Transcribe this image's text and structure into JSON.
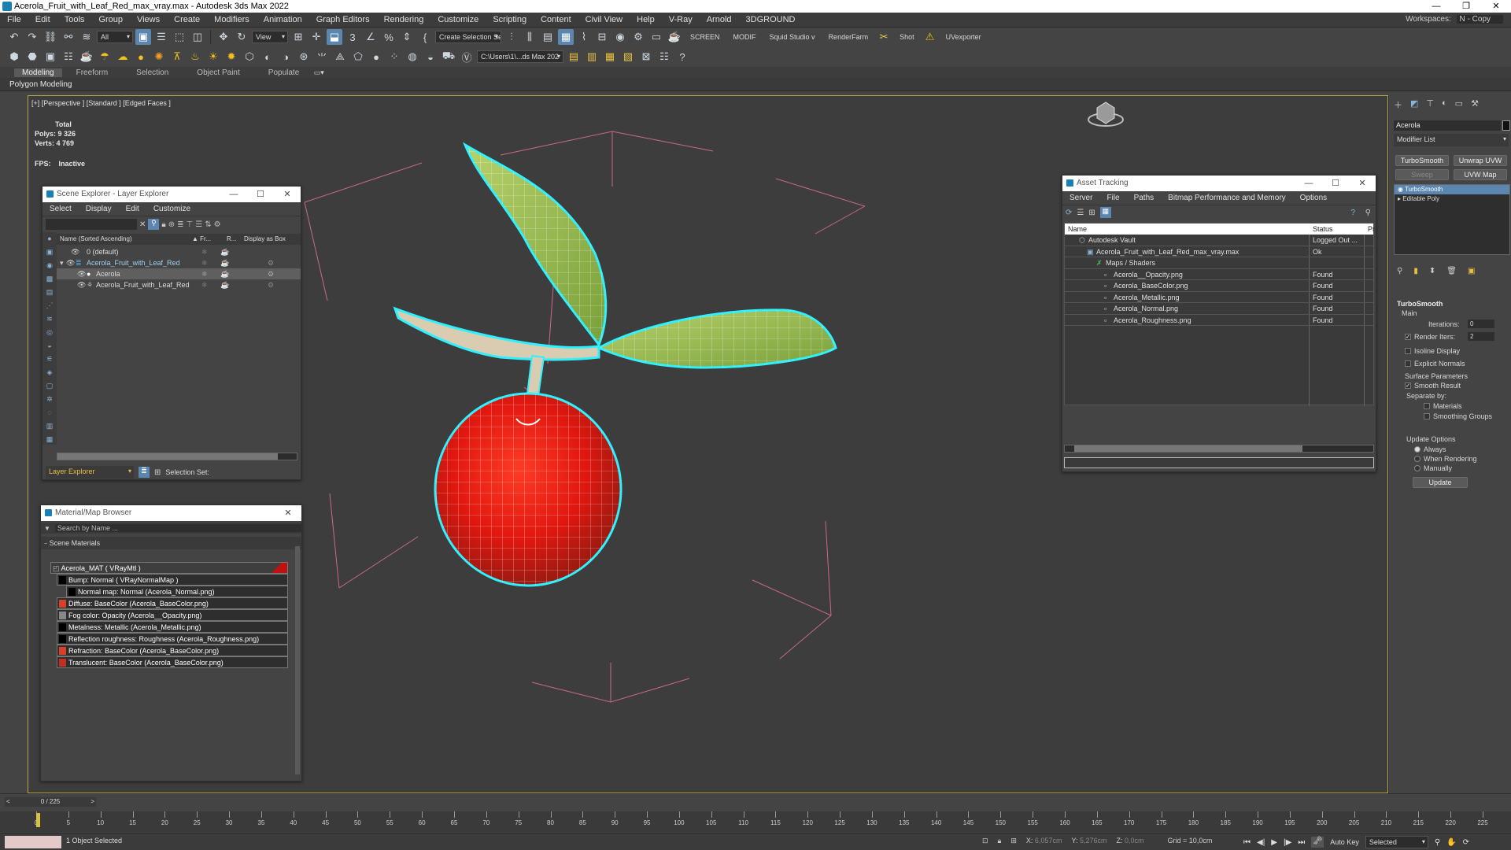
{
  "window": {
    "title": "Acerola_Fruit_with_Leaf_Red_max_vray.max - Autodesk 3ds Max 2022",
    "controls": [
      "—",
      "❐",
      "✕"
    ]
  },
  "menu": {
    "items": [
      "File",
      "Edit",
      "Tools",
      "Group",
      "Views",
      "Create",
      "Modifiers",
      "Animation",
      "Graph Editors",
      "Rendering",
      "Customize",
      "Scripting",
      "Content",
      "Civil View",
      "Help",
      "V-Ray",
      "Arnold",
      "3DGROUND"
    ],
    "workspaces_label": "Workspaces:",
    "workspaces_value": "N - Copy"
  },
  "toolbar": {
    "filter_dropdown": "All",
    "view_dropdown": "View",
    "selection_set": "Create Selection Se",
    "screen": "SCREEN",
    "modif": "MODIF",
    "squid": "Squid Studio v",
    "renderfarm": "RenderFarm",
    "shot": "Shot",
    "uvexporter": "UVexporter",
    "path_dropdown": "C:\\Users\\1\\...ds Max 202"
  },
  "ribbon": {
    "tabs": [
      "Modeling",
      "Freeform",
      "Selection",
      "Object Paint",
      "Populate"
    ],
    "sub": "Polygon Modeling"
  },
  "viewport": {
    "label": "[+] [Perspective ] [Standard ] [Edged Faces ]",
    "stats_header": "Total",
    "polys_label": "Polys:",
    "polys": "9 326",
    "verts_label": "Verts:",
    "verts": "4 769",
    "fps_label": "FPS:",
    "fps": "Inactive"
  },
  "scene_explorer": {
    "title": "Scene Explorer - Layer Explorer",
    "menu": [
      "Select",
      "Display",
      "Edit",
      "Customize"
    ],
    "columns": [
      "Name (Sorted Ascending)",
      "▲ Fr...",
      "R...",
      "Display as Box"
    ],
    "rows": [
      {
        "name": "0 (default)"
      },
      {
        "name": "Acerola_Fruit_with_Leaf_Red"
      },
      {
        "name": "Acerola"
      },
      {
        "name": "Acerola_Fruit_with_Leaf_Red"
      }
    ],
    "footer_dropdown": "Layer Explorer",
    "selection_set_label": "Selection Set:"
  },
  "material_browser": {
    "title": "Material/Map Browser",
    "search_placeholder": "Search by Name ...",
    "group": "Scene Materials",
    "items": [
      "Acerola_MAT  ( VRayMtl )",
      "Bump: Normal  ( VRayNormalMap )",
      "Normal map: Normal (Acerola_Normal.png)",
      "Diffuse: BaseColor (Acerola_BaseColor.png)",
      "Fog color: Opacity (Acerola__Opacity.png)",
      "Metalness: Metallic (Acerola_Metallic.png)",
      "Reflection roughness: Roughness (Acerola_Roughness.png)",
      "Refraction: BaseColor (Acerola_BaseColor.png)",
      "Translucent: BaseColor (Acerola_BaseColor.png)"
    ]
  },
  "asset_tracking": {
    "title": "Asset Tracking",
    "menu": [
      "Server",
      "File",
      "Paths",
      "Bitmap Performance and Memory",
      "Options"
    ],
    "columns": [
      "Name",
      "Status",
      "Pr"
    ],
    "rows": [
      {
        "name": "Autodesk Vault",
        "status": "Logged Out ..."
      },
      {
        "name": "Acerola_Fruit_with_Leaf_Red_max_vray.max",
        "status": "Ok"
      },
      {
        "name": "Maps / Shaders",
        "status": ""
      },
      {
        "name": "Acerola__Opacity.png",
        "status": "Found"
      },
      {
        "name": "Acerola_BaseColor.png",
        "status": "Found"
      },
      {
        "name": "Acerola_Metallic.png",
        "status": "Found"
      },
      {
        "name": "Acerola_Normal.png",
        "status": "Found"
      },
      {
        "name": "Acerola_Roughness.png",
        "status": "Found"
      }
    ]
  },
  "command_panel": {
    "object_name": "Acerola",
    "modifier_list": "Modifier List",
    "buttons": [
      "TurboSmooth",
      "Unwrap UVW",
      "Sweep",
      "UVW Map"
    ],
    "stack": [
      "TurboSmooth",
      "Editable Poly"
    ],
    "rollout": "TurboSmooth",
    "main": "Main",
    "iterations_label": "Iterations:",
    "iterations": "0",
    "render_iters_label": "Render Iters:",
    "render_iters": "2",
    "isoline": "Isoline Display",
    "explicit": "Explicit Normals",
    "surface": "Surface Parameters",
    "smooth_result": "Smooth Result",
    "separate_by": "Separate by:",
    "materials": "Materials",
    "smoothing_groups": "Smoothing Groups",
    "update_options": "Update Options",
    "always": "Always",
    "when_rendering": "When Rendering",
    "manually": "Manually",
    "update": "Update"
  },
  "timeline": {
    "frame": "0 / 225",
    "ticks": [
      "0",
      "5",
      "10",
      "15",
      "20",
      "25",
      "30",
      "35",
      "40",
      "45",
      "50",
      "55",
      "60",
      "65",
      "70",
      "75",
      "80",
      "85",
      "90",
      "95",
      "100",
      "105",
      "110",
      "115",
      "120",
      "125",
      "130",
      "135",
      "140",
      "145",
      "150",
      "155",
      "160",
      "165",
      "170",
      "175",
      "180",
      "185",
      "190",
      "195",
      "200",
      "205",
      "210",
      "215",
      "220",
      "225"
    ]
  },
  "status": {
    "selected": "1 Object Selected",
    "x_label": "X:",
    "x": "6,057cm",
    "y_label": "Y:",
    "y": "5,276cm",
    "z_label": "Z:",
    "z": "0,0cm",
    "grid": "Grid = 10,0cm",
    "autokey": "Auto Key",
    "selected_dd": "Selected"
  }
}
